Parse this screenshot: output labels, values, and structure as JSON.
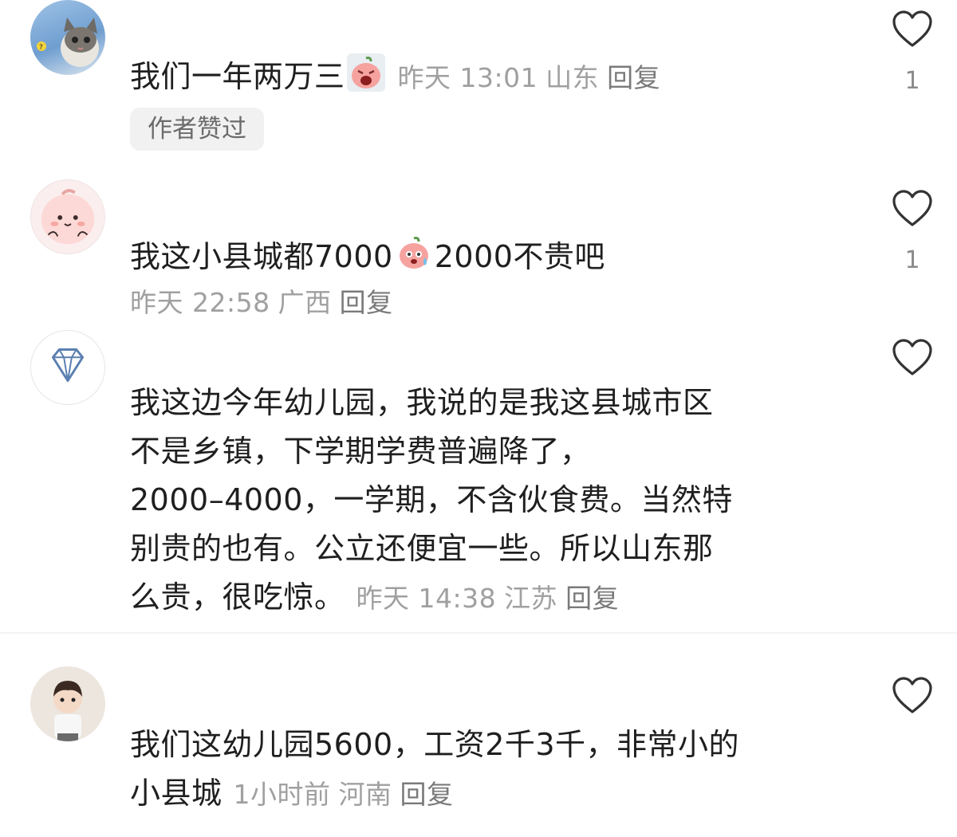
{
  "comments": [
    {
      "avatar": "cat-photo-avatar",
      "text": "我们一年两万三",
      "emoji": "crying-peach-emoji",
      "time": "昨天 13:01",
      "location": "山东",
      "reply": "回复",
      "badge": "作者赞过",
      "likes": "1"
    },
    {
      "avatar": "peach-cartoon-avatar",
      "text_before": "我这小县城都7000",
      "emoji": "sweating-peach-emoji",
      "text_after": "2000不贵吧",
      "time": "昨天 22:58",
      "location": "广西",
      "reply": "回复",
      "likes": "1"
    },
    {
      "avatar": "diamond-avatar",
      "lines": [
        "我这边今年幼儿园，我说的是我这县城市区",
        "不是乡镇，下学期学费普遍降了，",
        "2000–4000，一学期，不含伙食费。当然特",
        "别贵的也有。公立还便宜一些。所以山东那",
        "么贵，很吃惊。"
      ],
      "time": "昨天 14:38",
      "location": "江苏",
      "reply": "回复",
      "likes": ""
    },
    {
      "avatar": "child-photo-avatar",
      "lines": [
        "我们这幼儿园5600，工资2千3千，非常小的",
        "小县城"
      ],
      "time": "1小时前",
      "location": "河南",
      "reply": "回复",
      "likes": ""
    }
  ]
}
